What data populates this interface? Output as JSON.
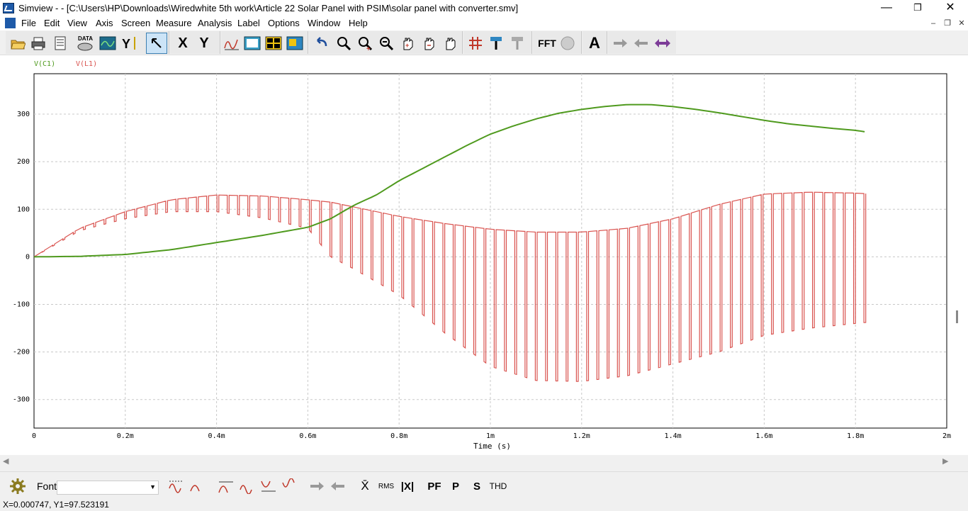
{
  "window": {
    "title": "Simview -  - [C:\\Users\\HP\\Downloads\\Wiredwhite 5th work\\Article 22 Solar Panel with PSIM\\solar panel with converter.smv]",
    "minimize": "—",
    "restore": "❐",
    "close": "✕"
  },
  "menu": {
    "items": [
      "File",
      "Edit",
      "View",
      "Axis",
      "Screen",
      "Measure",
      "Analysis",
      "Label",
      "Options",
      "Window",
      "Help"
    ],
    "mdi_min": "–",
    "mdi_restore": "❐",
    "mdi_close": "✕"
  },
  "toolbar": {
    "x_label": "X",
    "y_label": "Y",
    "fft_label": "FFT",
    "text_label": "A"
  },
  "bottom_toolbar": {
    "font_label": "Font",
    "font_value": "",
    "mean_label": "X̄",
    "rms_label": "RMS",
    "abs_label": "|X|",
    "pf_label": "PF",
    "p_label": "P",
    "s_label": "S",
    "thd_label": "THD"
  },
  "status": {
    "readout": "X=0.000747, Y1=97.523191"
  },
  "chart_data": {
    "type": "line",
    "xlabel": "Time (s)",
    "ylabel": "",
    "xlim": [
      0,
      0.002
    ],
    "ylim": [
      -360,
      385
    ],
    "x_ticks": [
      0,
      0.0002,
      0.0004,
      0.0006,
      0.0008,
      0.001,
      0.0012,
      0.0014,
      0.0016,
      0.0018,
      0.002
    ],
    "x_tick_labels": [
      "0",
      "0.2m",
      "0.4m",
      "0.6m",
      "0.8m",
      "1m",
      "1.2m",
      "1.4m",
      "1.6m",
      "1.8m",
      "2m"
    ],
    "y_ticks": [
      300,
      200,
      100,
      0,
      -100,
      -200,
      -300
    ],
    "y_tick_labels": [
      "300",
      "200",
      "100",
      "0",
      "-100",
      "-200",
      "-300"
    ],
    "grid": true,
    "legend_position": "top-left",
    "series": [
      {
        "name": "V(C1)",
        "color": "#4f9a1e",
        "x": [
          0,
          0.0001,
          0.0002,
          0.0003,
          0.0004,
          0.0005,
          0.0006,
          0.00065,
          0.0007,
          0.00075,
          0.0008,
          0.00085,
          0.0009,
          0.00095,
          0.001,
          0.00105,
          0.0011,
          0.00115,
          0.0012,
          0.00125,
          0.0013,
          0.00135,
          0.0014,
          0.00145,
          0.0015,
          0.00155,
          0.0016,
          0.00165,
          0.0017,
          0.00175,
          0.0018,
          0.00182
        ],
        "values": [
          0,
          1,
          5,
          15,
          30,
          45,
          62,
          80,
          108,
          130,
          160,
          185,
          210,
          235,
          258,
          275,
          290,
          302,
          310,
          316,
          320,
          320,
          316,
          310,
          303,
          295,
          287,
          280,
          275,
          270,
          266,
          263
        ]
      },
      {
        "name": "V(L1)",
        "color": "#d9534f",
        "x_start": 0,
        "x_end": 0.00182,
        "period": 2.25e-05,
        "upper_envelope": {
          "x": [
            0,
            0.0001,
            0.0002,
            0.0003,
            0.0004,
            0.0005,
            0.0006,
            0.00065,
            0.0007,
            0.0008,
            0.0009,
            0.001,
            0.0011,
            0.0012,
            0.0013,
            0.0014,
            0.0015,
            0.0016,
            0.0017,
            0.0018,
            0.00182
          ],
          "values": [
            0,
            60,
            95,
            120,
            130,
            128,
            120,
            115,
            105,
            85,
            70,
            58,
            52,
            52,
            60,
            80,
            110,
            132,
            136,
            134,
            133
          ]
        },
        "lower_envelope": {
          "x": [
            0,
            0.0001,
            0.0002,
            0.0003,
            0.0004,
            0.0005,
            0.0006,
            0.00065,
            0.0007,
            0.0008,
            0.0009,
            0.001,
            0.0011,
            0.0012,
            0.0013,
            0.0014,
            0.0015,
            0.0016,
            0.0017,
            0.0018,
            0.00182
          ],
          "values": [
            0,
            55,
            80,
            95,
            95,
            82,
            60,
            0,
            -25,
            -80,
            -160,
            -230,
            -260,
            -262,
            -250,
            -225,
            -200,
            -165,
            -150,
            -140,
            -138
          ]
        }
      }
    ]
  }
}
